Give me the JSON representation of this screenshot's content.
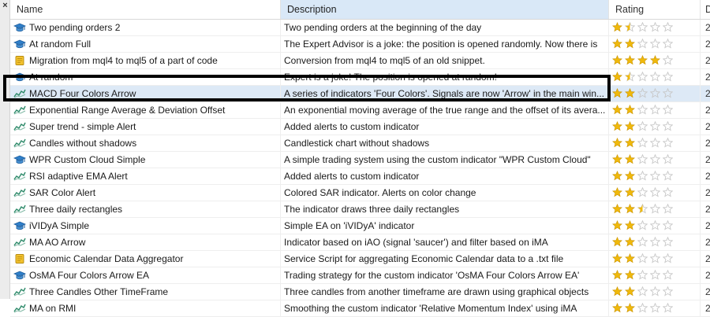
{
  "window": {
    "close_glyph": "×"
  },
  "columns": {
    "name": "Name",
    "description": "Description",
    "rating": "Rating",
    "extra": "D"
  },
  "colors": {
    "selected_row": "#dde9f6",
    "header_active": "#d9e8f7",
    "star_filled": "#f0b90b",
    "star_empty": "#c8c8c8"
  },
  "rows": [
    {
      "name": "Two pending orders 2",
      "desc": "Two pending orders at the beginning of the day",
      "icon": "expert-cap-icon",
      "rating": 1.5,
      "d": "2"
    },
    {
      "name": "At random Full",
      "desc": "The Expert Advisor is a joke: the position is opened randomly. Now there is",
      "icon": "expert-cap-icon",
      "rating": 2,
      "d": "2"
    },
    {
      "name": "Migration from mql4 to mql5 of a part of code",
      "desc": "Conversion from mql4 to mql5 of an old snippet.",
      "icon": "script-scroll-icon",
      "rating": 4,
      "d": "2"
    },
    {
      "name": "At random",
      "desc": "Expert is a joke! The position is opened at random!",
      "icon": "expert-cap-icon",
      "rating": 1.5,
      "d": "2"
    },
    {
      "name": "MACD Four Colors Arrow",
      "desc": "A series of indicators 'Four Colors'. Signals are now 'Arrow' in the main win...",
      "icon": "indicator-wave-icon",
      "rating": 2,
      "d": "2",
      "selected": true
    },
    {
      "name": "Exponential Range Average & Deviation Offset",
      "desc": "An exponential moving average of the true range and the offset of its avera...",
      "icon": "indicator-wave-icon",
      "rating": 2,
      "d": "2"
    },
    {
      "name": "Super trend - simple Alert",
      "desc": "Added alerts to custom indicator",
      "icon": "indicator-wave-icon",
      "rating": 2,
      "d": "2"
    },
    {
      "name": "Candles without shadows",
      "desc": "Candlestick chart without shadows",
      "icon": "indicator-wave-icon",
      "rating": 2,
      "d": "2"
    },
    {
      "name": "WPR Custom Cloud Simple",
      "desc": "A simple trading system using the custom indicator \"WPR Custom Cloud\"",
      "icon": "expert-cap-icon",
      "rating": 2,
      "d": "2"
    },
    {
      "name": "RSI adaptive EMA Alert",
      "desc": "Added alerts to custom indicator",
      "icon": "indicator-wave-icon",
      "rating": 2,
      "d": "2"
    },
    {
      "name": "SAR Color Alert",
      "desc": "Colored SAR indicator. Alerts on color change",
      "icon": "indicator-wave-icon",
      "rating": 2,
      "d": "2"
    },
    {
      "name": "Three daily rectangles",
      "desc": "The indicator draws three daily rectangles",
      "icon": "indicator-wave-icon",
      "rating": 2.5,
      "d": "2"
    },
    {
      "name": "iVIDyA Simple",
      "desc": "Simple EA on 'iVIDyA' indicator",
      "icon": "expert-cap-icon",
      "rating": 2,
      "d": "2"
    },
    {
      "name": "MA AO Arrow",
      "desc": "Indicator based on iAO (signal 'saucer') and filter based on iMA",
      "icon": "indicator-wave-icon",
      "rating": 2,
      "d": "2"
    },
    {
      "name": "Economic Calendar Data Aggregator",
      "desc": "Service Script for aggregating Economic Calendar data to a .txt file",
      "icon": "script-scroll-icon",
      "rating": 2,
      "d": "2"
    },
    {
      "name": "OsMA Four Colors Arrow EA",
      "desc": "Trading strategy for the custom indicator 'OsMA Four Colors Arrow EA'",
      "icon": "expert-cap-icon",
      "rating": 2,
      "d": "2"
    },
    {
      "name": "Three Candles Other TimeFrame",
      "desc": "Three candles from another timeframe are drawn using graphical objects",
      "icon": "indicator-wave-icon",
      "rating": 2,
      "d": "2"
    },
    {
      "name": "MA on RMI",
      "desc": "Smoothing the custom indicator 'Relative Momentum Index' using iMA",
      "icon": "indicator-wave-icon",
      "rating": 2,
      "d": "2"
    }
  ]
}
